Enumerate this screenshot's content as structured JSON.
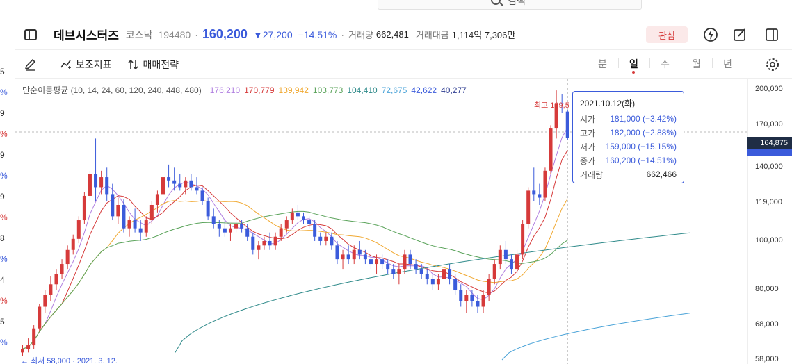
{
  "search": {
    "text": "검색"
  },
  "left_rail": [
    {
      "text": "5",
      "color": "dark"
    },
    {
      "text": "%",
      "color": "blue"
    },
    {
      "text": "9",
      "color": "dark"
    },
    {
      "text": "%",
      "color": "red"
    },
    {
      "text": "9",
      "color": "dark"
    },
    {
      "text": "%",
      "color": "blue"
    },
    {
      "text": "9",
      "color": "dark"
    },
    {
      "text": "%",
      "color": "red"
    },
    {
      "text": "8",
      "color": "dark"
    },
    {
      "text": "%",
      "color": "blue"
    },
    {
      "text": "4",
      "color": "dark"
    },
    {
      "text": "%",
      "color": "red"
    },
    {
      "text": "5",
      "color": "dark"
    },
    {
      "text": "%",
      "color": "blue"
    }
  ],
  "header": {
    "name": "데브시스터즈",
    "market": "코스닥",
    "code": "194480",
    "price": "160,200",
    "change": "▼27,200",
    "change_pct": "−14.51%",
    "volume_label": "거래량",
    "volume": "662,481",
    "amount_label": "거래대금",
    "amount": "1,114억 7,306만",
    "favorite_label": "관심"
  },
  "toolbar": {
    "indicator_label": "보조지표",
    "strategy_label": "매매전략",
    "periods": [
      "분",
      "일",
      "주",
      "월",
      "년"
    ],
    "active_period": "일"
  },
  "ma_legend": {
    "title": "단순이동평균 (10, 14, 24, 60, 120, 240, 448, 480)",
    "values": [
      {
        "text": "176,210",
        "color": "#b07fe0"
      },
      {
        "text": "170,779",
        "color": "#d63a3a"
      },
      {
        "text": "139,942",
        "color": "#f0a830"
      },
      {
        "text": "103,773",
        "color": "#5aa35a"
      },
      {
        "text": "104,410",
        "color": "#2f8a8a"
      },
      {
        "text": "72,675",
        "color": "#4aa3d8"
      },
      {
        "text": "42,622",
        "color": "#3b5bdb"
      },
      {
        "text": "40,277",
        "color": "#2b3a8f"
      }
    ]
  },
  "yaxis": {
    "ticks": [
      "200,000",
      "170,000",
      "140,000",
      "119,000",
      "100,000",
      "80,000",
      "68,000",
      "58,000"
    ],
    "current_price": "164,875"
  },
  "max_label": "최고 199,5",
  "min_label": "← 최저 58,000 · 2021. 3. 12.",
  "tooltip": {
    "date": "2021.10.12(화)",
    "rows": [
      {
        "k": "시가",
        "v": "181,000 (−3.42%)"
      },
      {
        "k": "고가",
        "v": "182,000 (−2.88%)"
      },
      {
        "k": "저가",
        "v": "159,000 (−15.15%)"
      },
      {
        "k": "종가",
        "v": "160,200 (−14.51%)"
      },
      {
        "k": "거래량",
        "v": "662,466"
      }
    ]
  },
  "colors": {
    "up": "#d63a3a",
    "down": "#3b5bdb",
    "accent": "#3b5bdb"
  },
  "chart_data": {
    "type": "candlestick",
    "title": "",
    "y_ticks": [
      200000,
      170000,
      140000,
      119000,
      100000,
      80000,
      68000,
      58000
    ],
    "ylim": [
      58000,
      210000
    ],
    "candles": [
      [
        60000,
        62000,
        59000,
        61000
      ],
      [
        61000,
        64000,
        60000,
        62000
      ],
      [
        62000,
        68000,
        61000,
        67000
      ],
      [
        67000,
        75000,
        66000,
        74000
      ],
      [
        74000,
        80000,
        72000,
        78000
      ],
      [
        78000,
        85000,
        76000,
        82000
      ],
      [
        82000,
        88000,
        80000,
        86000
      ],
      [
        86000,
        92000,
        84000,
        90000
      ],
      [
        90000,
        98000,
        88000,
        96000
      ],
      [
        96000,
        103000,
        94000,
        101000
      ],
      [
        101000,
        112000,
        99000,
        110000
      ],
      [
        110000,
        125000,
        108000,
        123000
      ],
      [
        123000,
        138000,
        120000,
        136000
      ],
      [
        136000,
        160000,
        120000,
        128000
      ],
      [
        128000,
        138000,
        124000,
        134000
      ],
      [
        134000,
        140000,
        120000,
        124000
      ],
      [
        124000,
        130000,
        110000,
        112000
      ],
      [
        112000,
        122000,
        108000,
        118000
      ],
      [
        118000,
        121000,
        104000,
        106000
      ],
      [
        106000,
        112000,
        102000,
        110000
      ],
      [
        110000,
        116000,
        104000,
        106000
      ],
      [
        106000,
        110000,
        100000,
        104000
      ],
      [
        104000,
        112000,
        102000,
        110000
      ],
      [
        110000,
        120000,
        108000,
        118000
      ],
      [
        118000,
        126000,
        114000,
        124000
      ],
      [
        124000,
        138000,
        120000,
        134000
      ],
      [
        134000,
        142000,
        128000,
        132000
      ],
      [
        132000,
        140000,
        126000,
        130000
      ],
      [
        130000,
        136000,
        126000,
        128000
      ],
      [
        128000,
        134000,
        124000,
        132000
      ],
      [
        132000,
        136000,
        126000,
        128000
      ],
      [
        128000,
        134000,
        124000,
        126000
      ],
      [
        126000,
        128000,
        118000,
        120000
      ],
      [
        120000,
        122000,
        110000,
        112000
      ],
      [
        112000,
        116000,
        106000,
        108000
      ],
      [
        108000,
        110000,
        102000,
        106000
      ],
      [
        106000,
        110000,
        102000,
        104000
      ],
      [
        104000,
        108000,
        100000,
        106000
      ],
      [
        106000,
        110000,
        104000,
        108000
      ],
      [
        108000,
        110000,
        104000,
        106000
      ],
      [
        106000,
        108000,
        100000,
        102000
      ],
      [
        102000,
        104000,
        94000,
        96000
      ],
      [
        96000,
        100000,
        92000,
        98000
      ],
      [
        98000,
        102000,
        96000,
        100000
      ],
      [
        100000,
        104000,
        96000,
        98000
      ],
      [
        98000,
        104000,
        96000,
        102000
      ],
      [
        102000,
        108000,
        100000,
        106000
      ],
      [
        106000,
        112000,
        104000,
        110000
      ],
      [
        110000,
        116000,
        108000,
        114000
      ],
      [
        114000,
        118000,
        110000,
        112000
      ],
      [
        112000,
        114000,
        108000,
        110000
      ],
      [
        110000,
        112000,
        106000,
        108000
      ],
      [
        108000,
        110000,
        100000,
        102000
      ],
      [
        102000,
        104000,
        98000,
        100000
      ],
      [
        100000,
        104000,
        98000,
        102000
      ],
      [
        102000,
        104000,
        96000,
        98000
      ],
      [
        98000,
        100000,
        90000,
        92000
      ],
      [
        92000,
        96000,
        88000,
        94000
      ],
      [
        94000,
        98000,
        90000,
        92000
      ],
      [
        92000,
        98000,
        90000,
        96000
      ],
      [
        96000,
        100000,
        92000,
        94000
      ],
      [
        94000,
        96000,
        90000,
        92000
      ],
      [
        92000,
        94000,
        88000,
        90000
      ],
      [
        90000,
        94000,
        86000,
        92000
      ],
      [
        92000,
        94000,
        88000,
        90000
      ],
      [
        90000,
        92000,
        86000,
        88000
      ],
      [
        88000,
        90000,
        84000,
        86000
      ],
      [
        86000,
        90000,
        82000,
        88000
      ],
      [
        88000,
        96000,
        86000,
        94000
      ],
      [
        94000,
        96000,
        88000,
        90000
      ],
      [
        90000,
        92000,
        86000,
        88000
      ],
      [
        88000,
        90000,
        84000,
        86000
      ],
      [
        86000,
        88000,
        82000,
        84000
      ],
      [
        84000,
        86000,
        80000,
        82000
      ],
      [
        82000,
        86000,
        80000,
        84000
      ],
      [
        84000,
        90000,
        82000,
        88000
      ],
      [
        88000,
        90000,
        82000,
        84000
      ],
      [
        84000,
        86000,
        78000,
        80000
      ],
      [
        80000,
        82000,
        74000,
        76000
      ],
      [
        76000,
        80000,
        72000,
        78000
      ],
      [
        78000,
        80000,
        74000,
        76000
      ],
      [
        76000,
        78000,
        72000,
        74000
      ],
      [
        74000,
        80000,
        72000,
        78000
      ],
      [
        78000,
        86000,
        76000,
        84000
      ],
      [
        84000,
        92000,
        82000,
        90000
      ],
      [
        90000,
        98000,
        88000,
        96000
      ],
      [
        96000,
        100000,
        90000,
        92000
      ],
      [
        92000,
        94000,
        86000,
        88000
      ],
      [
        88000,
        96000,
        86000,
        94000
      ],
      [
        94000,
        110000,
        92000,
        108000
      ],
      [
        108000,
        128000,
        106000,
        126000
      ],
      [
        126000,
        140000,
        120000,
        124000
      ],
      [
        124000,
        130000,
        118000,
        122000
      ],
      [
        122000,
        140000,
        120000,
        138000
      ],
      [
        138000,
        170000,
        136000,
        168000
      ],
      [
        168000,
        199500,
        160000,
        188000
      ],
      [
        188000,
        196000,
        180000,
        187400
      ],
      [
        181000,
        182000,
        159000,
        160200
      ]
    ],
    "moving_averages": [
      {
        "name": "10",
        "color": "#b07fe0",
        "value": 176210
      },
      {
        "name": "14",
        "color": "#d63a3a",
        "value": 170779
      },
      {
        "name": "24",
        "color": "#f0a830",
        "value": 139942
      },
      {
        "name": "60",
        "color": "#5aa35a",
        "value": 103773
      },
      {
        "name": "120",
        "color": "#2f8a8a",
        "value": 104410
      },
      {
        "name": "240",
        "color": "#4aa3d8",
        "value": 72675
      },
      {
        "name": "448",
        "color": "#3b5bdb",
        "value": 42622
      },
      {
        "name": "480",
        "color": "#2b3a8f",
        "value": 40277
      }
    ],
    "grid": false
  }
}
